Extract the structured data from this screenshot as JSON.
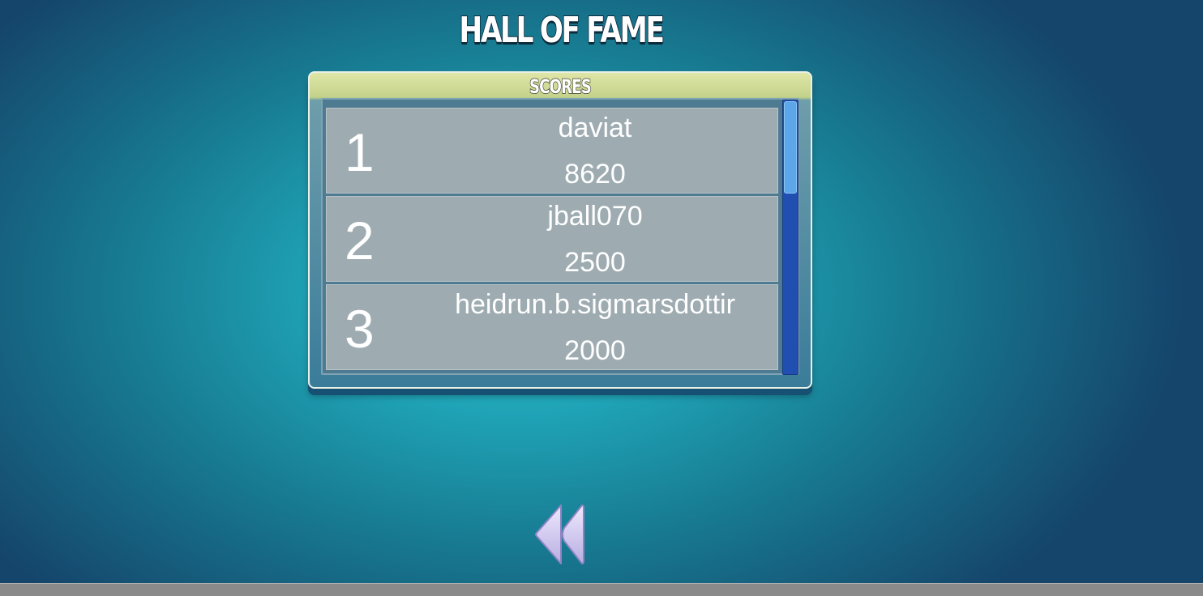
{
  "title": "HALL OF FAME",
  "panel": {
    "header": "SCORES"
  },
  "scores": [
    {
      "rank": "1",
      "name": "daviat",
      "score": "8620"
    },
    {
      "rank": "2",
      "name": "jball070",
      "score": "2500"
    },
    {
      "rank": "3",
      "name": "heidrun.b.sigmarsdottir",
      "score": "2000"
    }
  ],
  "icons": {
    "back": "rewind-icon"
  },
  "colors": {
    "background": "#1fa2b5",
    "row": "#9eacb2",
    "scrollbar": "#214fb1",
    "scroll_thumb": "#5da7e8",
    "panel_header": "#c3d28a",
    "back_button": "#cfc6ec"
  }
}
